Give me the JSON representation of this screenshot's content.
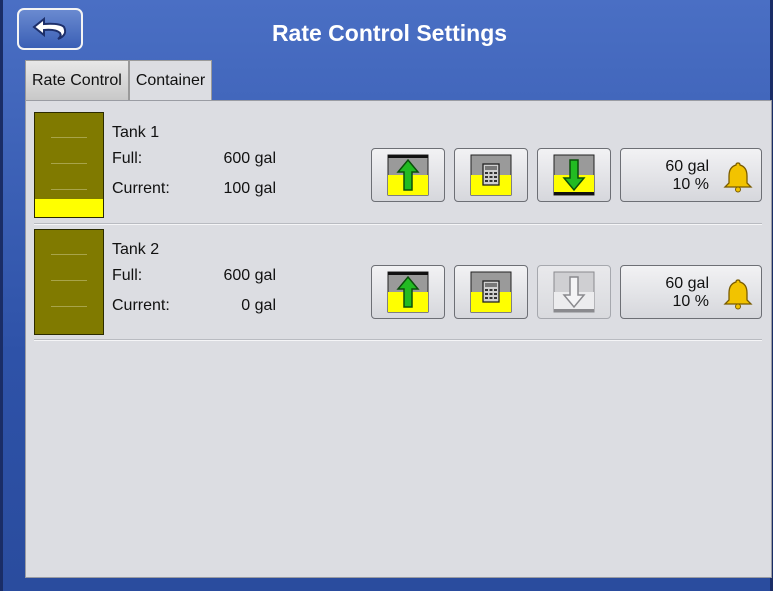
{
  "header": {
    "title": "Rate Control Settings"
  },
  "tabs": [
    {
      "label": "Rate Control"
    },
    {
      "label": "Container"
    }
  ],
  "tanks": [
    {
      "name": "Tank 1",
      "full_label": "Full:",
      "full_value": "600 gal",
      "current_label": "Current:",
      "current_value": "100 gal",
      "fill_level": 0.167,
      "fill_disabled": false,
      "alarm_amount": "60 gal",
      "alarm_percent": "10 %"
    },
    {
      "name": "Tank 2",
      "full_label": "Full:",
      "full_value": "600 gal",
      "current_label": "Current:",
      "current_value": "0 gal",
      "fill_level": 0,
      "fill_disabled": true,
      "alarm_amount": "60 gal",
      "alarm_percent": "10 %"
    }
  ],
  "icons": {
    "back": "back-arrow-icon",
    "fill": "fill-tank-icon",
    "calculate": "calculator-icon",
    "empty": "empty-tank-icon",
    "alarm": "bell-icon"
  },
  "colors": {
    "accent": "#2e52a8",
    "tank": "#807a00",
    "tank_fill": "#ffff00",
    "arrow": "#22bb22",
    "alarm_bell": "#f2c300"
  }
}
